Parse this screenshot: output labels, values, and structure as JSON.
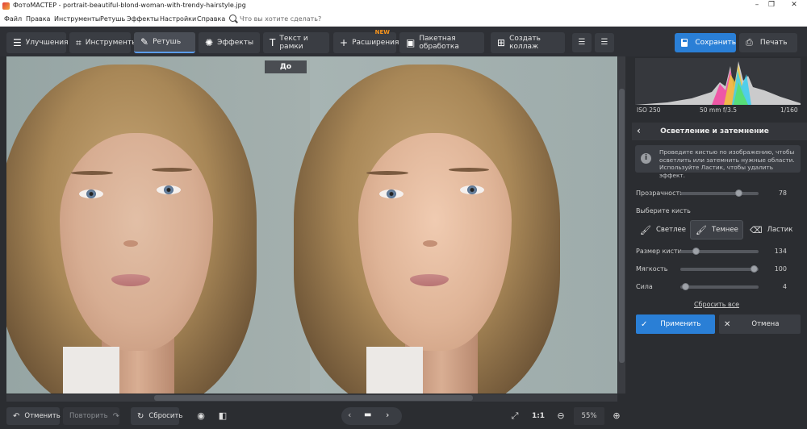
{
  "window": {
    "title": "ФотоМАСТЕР - portrait-beautiful-blond-woman-with-trendy-hairstyle.jpg",
    "minimize": "–",
    "maximize": "❐",
    "close": "✕"
  },
  "menu": {
    "items": [
      "Файл",
      "Правка",
      "Инструменты",
      "Ретушь",
      "Эффекты",
      "Настройки",
      "Справка"
    ],
    "search_placeholder": "Что вы хотите сделать?"
  },
  "toolbar": {
    "tabs": [
      {
        "label": "Улучшения",
        "icon": "sliders-icon"
      },
      {
        "label": "Инструменты",
        "icon": "crop-icon"
      },
      {
        "label": "Ретушь",
        "icon": "brush-icon",
        "active": true
      },
      {
        "label": "Эффекты",
        "icon": "sparkle-icon"
      },
      {
        "label": "Текст и рамки",
        "icon": "text-icon"
      },
      {
        "label": "Расширения",
        "icon": "plus-icon",
        "badge": "NEW"
      },
      {
        "label": "Пакетная обработка",
        "icon": "image-icon"
      },
      {
        "label": "Создать коллаж",
        "icon": "collage-icon"
      }
    ],
    "save_label": "Сохранить",
    "print_label": "Печать"
  },
  "canvas": {
    "before_label": "До"
  },
  "bottom": {
    "undo_label": "Отменить",
    "redo_label": "Повторить",
    "reset_label": "Сбросить",
    "ratio_label": "1:1",
    "zoom": "55%"
  },
  "panel": {
    "exif": {
      "iso": "ISO 250",
      "lens": "50 mm f/3.5",
      "shutter": "1/160"
    },
    "section_title": "Осветление и затемнение",
    "info_text": "Проведите кистью по изображению, чтобы осветлить или затемнить нужные области. Используйте Ластик, чтобы удалить эффект.",
    "opacity_label": "Прозрачность",
    "opacity_value": "78",
    "brush_prompt": "Выберите кисть",
    "brushes": [
      "Светлее",
      "Темнее",
      "Ластик"
    ],
    "active_brush": "Темнее",
    "size_label": "Размер кисти",
    "size_value": "134",
    "softness_label": "Мягкость",
    "softness_value": "100",
    "strength_label": "Сила",
    "strength_value": "4",
    "reset_all": "Сбросить все",
    "apply_label": "Применить",
    "cancel_label": "Отмена"
  },
  "colors": {
    "accent": "#2a7fd6",
    "new_badge": "#f7941d",
    "background": "#2b2d31"
  }
}
